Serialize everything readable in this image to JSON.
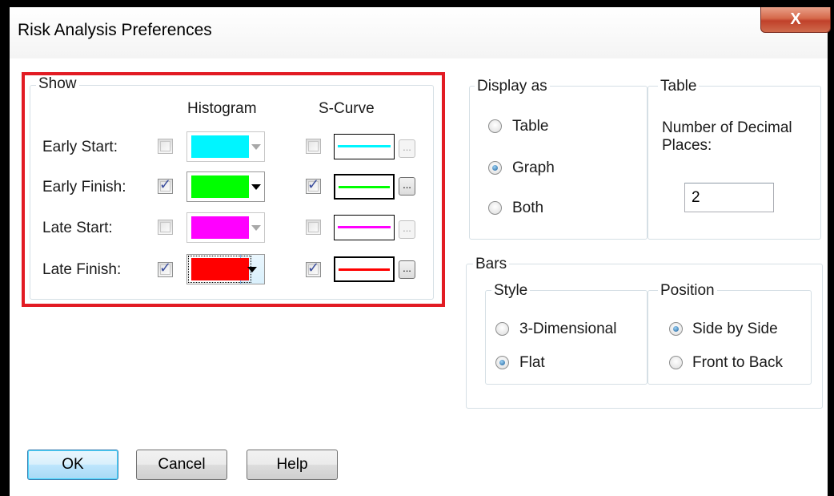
{
  "window": {
    "title": "Risk Analysis Preferences",
    "close_glyph": "X"
  },
  "show": {
    "label": "Show",
    "col_histogram": "Histogram",
    "col_scurve": "S-Curve",
    "rows": [
      {
        "label": "Early Start:",
        "hist_checked": false,
        "color": "#00f5ff",
        "enabled": false,
        "curve_checked": false
      },
      {
        "label": "Early Finish:",
        "hist_checked": true,
        "color": "#00ff00",
        "enabled": true,
        "curve_checked": true
      },
      {
        "label": "Late Start:",
        "hist_checked": false,
        "color": "#ff00ff",
        "enabled": false,
        "curve_checked": false
      },
      {
        "label": "Late Finish:",
        "hist_checked": true,
        "color": "#ff0000",
        "enabled": true,
        "curve_checked": true
      }
    ],
    "ellipsis": "..."
  },
  "display_as": {
    "label": "Display as",
    "options": [
      "Table",
      "Graph",
      "Both"
    ],
    "selected": "Graph"
  },
  "table": {
    "label": "Table",
    "decimal_label": "Number of Decimal Places:",
    "decimal_value": "2"
  },
  "bars": {
    "label": "Bars",
    "style": {
      "label": "Style",
      "options": [
        "3-Dimensional",
        "Flat"
      ],
      "selected": "Flat"
    },
    "position": {
      "label": "Position",
      "options": [
        "Side by Side",
        "Front to Back"
      ],
      "selected": "Side by Side"
    }
  },
  "buttons": {
    "ok": "OK",
    "cancel": "Cancel",
    "help": "Help"
  },
  "colors": {
    "highlight": "#e21b23"
  }
}
